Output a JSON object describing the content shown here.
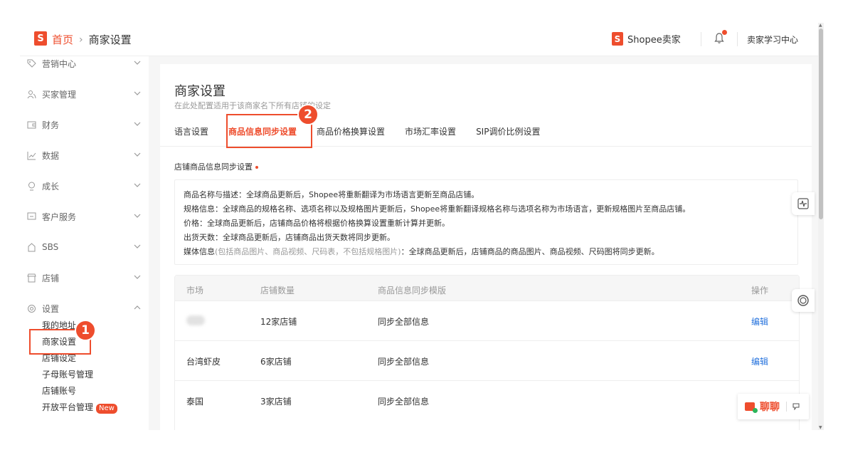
{
  "header": {
    "logo_letter": "S",
    "breadcrumb": {
      "home": "首页",
      "separator": "›",
      "current": "商家设置"
    },
    "brand_logo_letter": "S",
    "brand": "Shopee卖家",
    "learning_center": "卖家学习中心"
  },
  "sidebar": {
    "items": [
      {
        "label": "营销中心",
        "icon": "tag-icon"
      },
      {
        "label": "买家管理",
        "icon": "users-icon"
      },
      {
        "label": "财务",
        "icon": "wallet-icon"
      },
      {
        "label": "数据",
        "icon": "chart-icon"
      },
      {
        "label": "成长",
        "icon": "growth-icon"
      },
      {
        "label": "客户服务",
        "icon": "chat-icon"
      },
      {
        "label": "SBS",
        "icon": "sbs-icon"
      },
      {
        "label": "店铺",
        "icon": "shop-icon"
      },
      {
        "label": "设置",
        "icon": "gear-icon"
      }
    ],
    "sub_items": [
      "我的地址",
      "商家设置",
      "店铺设定",
      "子母账号管理",
      "店铺账号",
      "开放平台管理"
    ],
    "new_badge": "New"
  },
  "main": {
    "title": "商家设置",
    "subtitle": "在此处配置适用于该商家名下所有店铺的设定",
    "tabs": [
      "语言设置",
      "商品信息同步设置",
      "商品价格换算设置",
      "市场汇率设置",
      "SIP调价比例设置"
    ],
    "active_tab": "商品信息同步设置",
    "section_title": "店铺商品信息同步设置",
    "info": {
      "line1": "商品名称与描述：全球商品更新后，Shopee将重新翻译为市场语言更新至商品店铺。",
      "line2": "规格信息：全球商品的规格名称、选项名称以及规格图片更新后，Shopee将重新翻译规格名称与选项名称为市场语言，更新规格图片至商品店铺。",
      "line3": "价格：全球商品更新后，店铺商品价格将根据价格换算设置重新计算并更新。",
      "line4": "出货天数：全球商品更新后，店铺商品出货天数将同步更新。",
      "line5_label": "媒体信息",
      "line5_note": "(包括商品图片、商品视频、尺码表，不包括规格图片)",
      "line5_rest": "：全球商品更新后，店铺商品的商品图片、商品视频、尺码图将同步更新。"
    },
    "table": {
      "headers": [
        "市场",
        "店铺数量",
        "商品信息同步模版",
        "操作"
      ],
      "rows": [
        {
          "market": "",
          "count": "12家店铺",
          "template": "同步全部信息",
          "action": "编辑"
        },
        {
          "market": "台湾虾皮",
          "count": "6家店铺",
          "template": "同步全部信息",
          "action": "编辑"
        },
        {
          "market": "泰国",
          "count": "3家店铺",
          "template": "同步全部信息",
          "action": ""
        }
      ]
    }
  },
  "chat": {
    "label": "聊聊"
  },
  "annotations": [
    "1",
    "2"
  ],
  "colors": {
    "brand": "#ee4d2d",
    "link": "#2673dd"
  }
}
